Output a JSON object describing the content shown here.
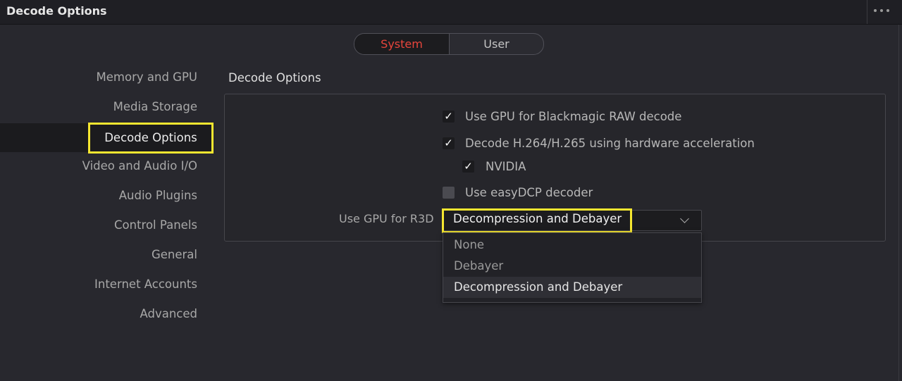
{
  "window": {
    "title": "Decode Options"
  },
  "toggle": {
    "system": "System",
    "user": "User"
  },
  "sidebar": {
    "items": [
      {
        "label": "Memory and GPU"
      },
      {
        "label": "Media Storage"
      },
      {
        "label": "Decode Options"
      },
      {
        "label": "Video and Audio I/O"
      },
      {
        "label": "Audio Plugins"
      },
      {
        "label": "Control Panels"
      },
      {
        "label": "General"
      },
      {
        "label": "Internet Accounts"
      },
      {
        "label": "Advanced"
      }
    ],
    "active": "Decode Options"
  },
  "section": {
    "title": "Decode Options"
  },
  "options": {
    "braw_gpu": {
      "label": "Use GPU for Blackmagic RAW decode",
      "checked": true
    },
    "h264_hw": {
      "label": "Decode H.264/H.265 using hardware acceleration",
      "checked": true
    },
    "nvidia": {
      "label": "NVIDIA",
      "checked": true
    },
    "easydcp": {
      "label": "Use easyDCP decoder",
      "checked": false
    }
  },
  "r3d": {
    "label": "Use GPU for R3D",
    "value": "Decompression and Debayer",
    "options": [
      "None",
      "Debayer",
      "Decompression and Debayer"
    ]
  },
  "colors": {
    "accent_red": "#e8453c",
    "highlight_yellow": "#f5e630",
    "background": "#28282e"
  }
}
